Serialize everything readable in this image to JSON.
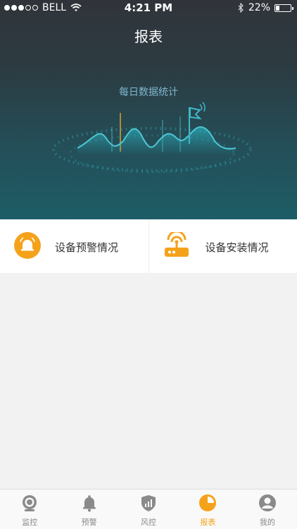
{
  "status_bar": {
    "carrier": "BELL",
    "time": "4:21 PM",
    "battery": "22%",
    "battery_level": 0.22
  },
  "nav": {
    "title": "报表"
  },
  "banner": {
    "title": "每日数据统计"
  },
  "cards": [
    {
      "label": "设备预警情况",
      "icon": "alarm-bell-icon"
    },
    {
      "label": "设备安装情况",
      "icon": "router-icon"
    }
  ],
  "tabs": [
    {
      "label": "监控",
      "icon": "camera-icon",
      "active": false
    },
    {
      "label": "预警",
      "icon": "bell-icon",
      "active": false
    },
    {
      "label": "风控",
      "icon": "shield-chart-icon",
      "active": false
    },
    {
      "label": "报表",
      "icon": "pie-chart-icon",
      "active": true
    },
    {
      "label": "我的",
      "icon": "user-icon",
      "active": false
    }
  ],
  "colors": {
    "accent": "#f5a21b",
    "header_top": "#30343a",
    "header_bottom": "#1e5d66",
    "inactive_tab": "#8a8a8a"
  }
}
